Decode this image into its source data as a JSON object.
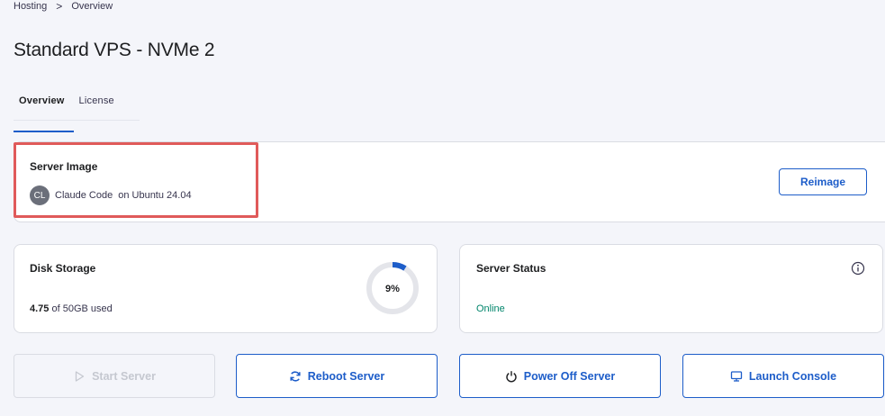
{
  "breadcrumb": {
    "items": [
      "Hosting",
      "Overview"
    ],
    "separator": ">"
  },
  "page": {
    "title": "Standard VPS - NVMe 2"
  },
  "tabs": [
    {
      "label": "Overview",
      "active": true
    },
    {
      "label": "License",
      "active": false
    }
  ],
  "server_image": {
    "title": "Server Image",
    "avatar_initials": "CL",
    "image_name": "Claude Code",
    "os_text": "on Ubuntu 24.04",
    "reimage_label": "Reimage"
  },
  "disk_storage": {
    "title": "Disk Storage",
    "used": "4.75",
    "total_text": "of 50GB used",
    "percent_label": "9%",
    "percent": 9
  },
  "server_status": {
    "title": "Server Status",
    "status": "Online",
    "status_color": "#00856b"
  },
  "actions": {
    "start": {
      "label": "Start Server",
      "icon": "play-icon",
      "disabled": true
    },
    "reboot": {
      "label": "Reboot Server",
      "icon": "refresh-icon",
      "disabled": false
    },
    "power_off": {
      "label": "Power Off Server",
      "icon": "power-icon",
      "disabled": false
    },
    "console": {
      "label": "Launch Console",
      "icon": "monitor-icon",
      "disabled": false
    }
  },
  "colors": {
    "accent": "#1d5dc9",
    "highlight": "#e05a5a"
  }
}
